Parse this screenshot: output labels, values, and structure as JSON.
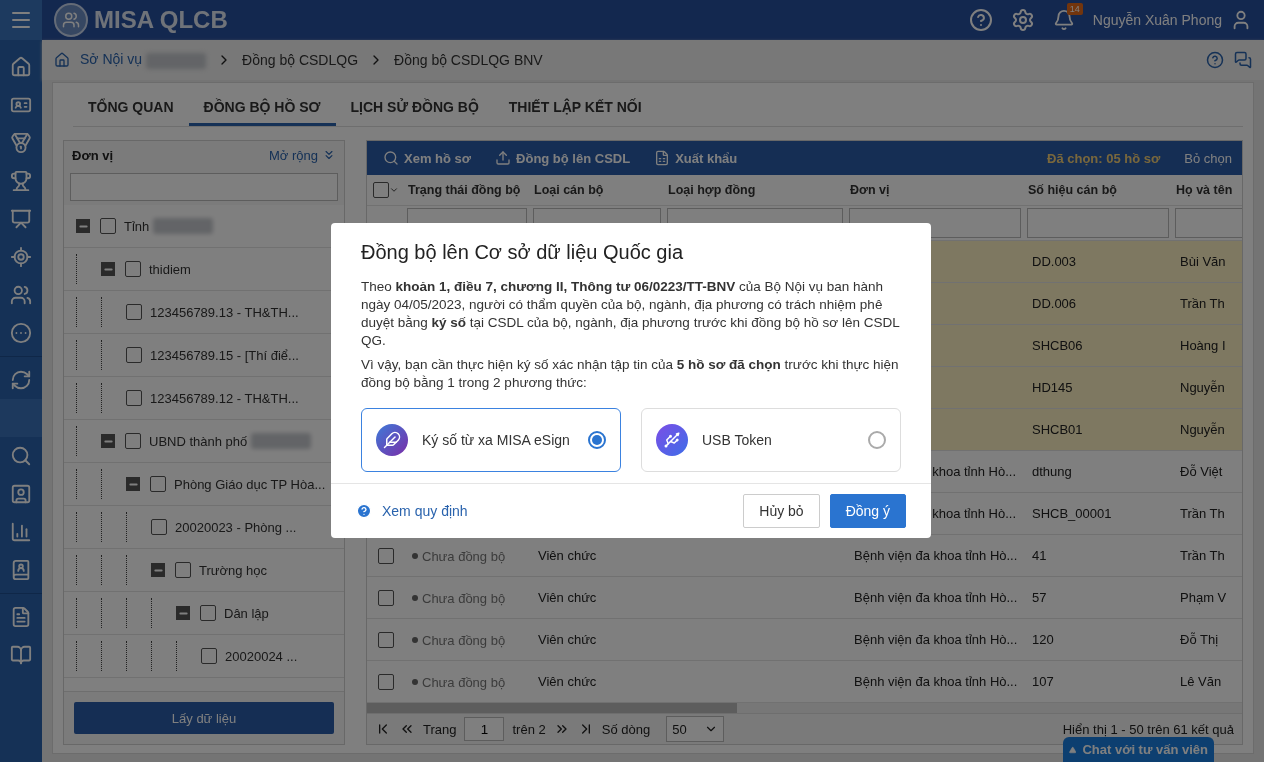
{
  "header": {
    "logo_text": "MISA QLCB",
    "notification_count": "14",
    "user_name": "Nguyễn Xuân Phong"
  },
  "breadcrumb": [
    {
      "label": "Sở Nội vụ",
      "redacted": true
    },
    {
      "label": "Đồng bộ CSDLQG",
      "redacted": false
    },
    {
      "label": "Đồng bộ CSDLQG BNV",
      "redacted": false
    }
  ],
  "tabs": [
    {
      "label": "TỔNG QUAN",
      "selected": false
    },
    {
      "label": "ĐỒNG BỘ HỒ SƠ",
      "selected": true
    },
    {
      "label": "LỊCH SỬ ĐỒNG BỘ",
      "selected": false
    },
    {
      "label": "THIẾT LẬP KẾT NỐI",
      "selected": false
    }
  ],
  "unit_panel": {
    "title": "Đơn vị",
    "expand_link": "Mở rộng",
    "button": "Lấy dữ liệu",
    "tree": [
      {
        "label": "Tỉnh",
        "redacted": true,
        "checked": false,
        "expanded": true,
        "children": [
          {
            "label": "thidiem",
            "redacted": false,
            "checked": false,
            "expanded": true,
            "children": [
              {
                "label": "123456789.13 - TH&TH...",
                "redacted": false,
                "checked": false
              },
              {
                "label": "123456789.15 - [Thí điể...",
                "redacted": false,
                "checked": false
              },
              {
                "label": "123456789.12 - TH&TH...",
                "redacted": false,
                "checked": false
              }
            ]
          },
          {
            "label": "UBND thành phố",
            "redacted": true,
            "checked": false,
            "expanded": true,
            "children": [
              {
                "label": "Phòng Giáo dục TP Hòa...",
                "redacted": false,
                "checked": false,
                "expanded": true,
                "children": [
                  {
                    "label": "20020023 - Phòng ...",
                    "redacted": false,
                    "checked": false
                  },
                  {
                    "label": "Trường học",
                    "redacted": false,
                    "checked": false,
                    "expanded": true,
                    "children": [
                      {
                        "label": "Dân lập",
                        "redacted": false,
                        "checked": false,
                        "expanded": true,
                        "children": [
                          {
                            "label": "20020024 ...",
                            "redacted": false,
                            "checked": false
                          }
                        ]
                      }
                    ]
                  }
                ]
              }
            ]
          }
        ]
      }
    ]
  },
  "table_toolbar": {
    "actions": [
      {
        "kind": "view",
        "label": "Xem hồ sơ"
      },
      {
        "kind": "sync",
        "label": "Đồng bộ lên CSDL"
      },
      {
        "kind": "export",
        "label": "Xuất khẩu"
      }
    ],
    "selected_count": "Đã chọn: 05 hồ sơ",
    "clear_selection": "Bỏ chọn"
  },
  "table": {
    "header_checked": false,
    "columns": [
      "Trạng thái đồng bộ",
      "Loại cán bộ",
      "Loại hợp đồng",
      "Đơn vị",
      "Số hiệu cán bộ",
      "Họ và tên"
    ],
    "rows": [
      {
        "selected": true,
        "staff_code": "DD.003",
        "full_name": "Bùi Văn"
      },
      {
        "selected": true,
        "staff_code": "DD.006",
        "full_name": "Trần Th"
      },
      {
        "selected": true,
        "staff_code": "SHCB06",
        "full_name": "Hoàng I"
      },
      {
        "selected": true,
        "staff_code": "HD145",
        "full_name": "Nguyễn"
      },
      {
        "selected": true,
        "staff_code": "SHCB01",
        "full_name": "Nguyễn"
      },
      {
        "selected": false,
        "unit": "khoa tỉnh Hò...",
        "staff_code": "dthung",
        "full_name": "Đỗ Việt"
      },
      {
        "selected": false,
        "unit": "khoa tỉnh Hò...",
        "staff_code": "SHCB_00001",
        "full_name": "Trần Th"
      },
      {
        "selected": false,
        "status": "Chưa đồng bộ",
        "staff_type": "Viên chức",
        "unit": "Bệnh viện đa khoa tỉnh Hò...",
        "staff_code": "41",
        "full_name": "Trần Th"
      },
      {
        "selected": false,
        "status": "Chưa đồng bộ",
        "staff_type": "Viên chức",
        "unit": "Bệnh viện đa khoa tỉnh Hò...",
        "staff_code": "57",
        "full_name": "Phạm V"
      },
      {
        "selected": false,
        "status": "Chưa đồng bộ",
        "staff_type": "Viên chức",
        "unit": "Bệnh viện đa khoa tỉnh Hò...",
        "staff_code": "120",
        "full_name": "Đỗ Thị"
      },
      {
        "selected": false,
        "status": "Chưa đồng bộ",
        "staff_type": "Viên chức",
        "unit": "Bệnh viện đa khoa tỉnh Hò...",
        "staff_code": "107",
        "full_name": "Lê Văn"
      }
    ]
  },
  "pagination": {
    "page_label": "Trang",
    "page": "1",
    "page_total": "trên 2",
    "rows_label": "Số dòng",
    "rows_per_page": "50",
    "summary": "Hiển thị 1 - 50 trên 61 kết quả"
  },
  "chat_button": "Chat với tư vấn viên",
  "modal": {
    "title": "Đồng bộ lên Cơ sở dữ liệu Quốc gia",
    "paragraphs": [
      "Theo **khoản 1, điều 7, chương II, Thông tư 06/0223/TT-BNV** của Bộ Nội vụ ban hành ngày 04/05/2023, người có thẩm quyền của bộ, ngành, địa phương có trách nhiệm phê duyệt bằng **ký số** tại CSDL của bộ, ngành, địa phương trước khi đồng bộ hồ sơ lên CSDL QG.",
      "Vì vậy, bạn cần thực hiện ký số xác nhận tập tin của **5 hồ sơ đã chọn** trước khi thực hiện đồng bộ bằng 1 trong 2 phương thức:"
    ],
    "options": [
      {
        "kind": "esign",
        "label": "Ký số từ xa MISA eSign",
        "selected": true
      },
      {
        "kind": "usb",
        "label": "USB Token",
        "selected": false
      }
    ],
    "help_link": "Xem quy định",
    "cancel": "Hủy bỏ",
    "confirm": "Đồng ý"
  }
}
